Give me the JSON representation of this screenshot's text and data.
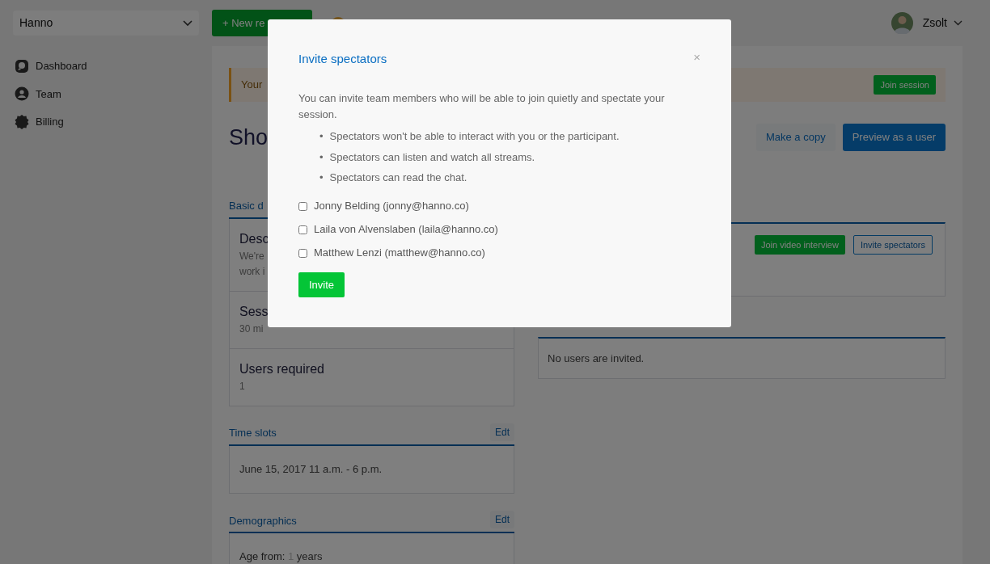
{
  "sidebar": {
    "team_selector": {
      "value": "Hanno"
    },
    "items": [
      {
        "label": "Dashboard",
        "kind": "dashboard"
      },
      {
        "label": "Team",
        "kind": "team"
      },
      {
        "label": "Billing",
        "kind": "billing"
      }
    ]
  },
  "top_bar": {
    "new_button": "+ New re",
    "user": {
      "name": "Zsolt"
    }
  },
  "alert": {
    "text": "Your",
    "button": "Join session"
  },
  "page": {
    "title": "Sho",
    "actions": [
      {
        "label": "Make a copy",
        "kind": "light"
      },
      {
        "label": "Preview as a user",
        "kind": "primary"
      }
    ]
  },
  "left_sections": [
    {
      "title": "Basic d",
      "rows": [
        {
          "label": "Desc",
          "lines": [
            "We're",
            "work i"
          ]
        },
        {
          "label": "Sess",
          "lines": [
            "30 mi"
          ]
        },
        {
          "label": "Users required",
          "lines": [
            "1"
          ]
        }
      ]
    },
    {
      "title": "Time slots",
      "edit": "Edt",
      "rows": [
        {
          "lines": [
            "June 15, 2017 11 a.m. - 6 p.m."
          ]
        }
      ]
    },
    {
      "title": "Demographics",
      "edit": "Edt",
      "rows": [
        {
          "label": "Age from:",
          "value": "1",
          "unit": "years"
        },
        {
          "lines": []
        }
      ]
    }
  ],
  "sessions_panel": {
    "buttons": [
      {
        "label": "Join video interview",
        "kind": "success"
      },
      {
        "label": "Invite spectators",
        "kind": "outline"
      }
    ]
  },
  "invited_panel": {
    "text": "No users are invited."
  },
  "modal": {
    "title": "Invite spectators",
    "close": "×",
    "intro": "You can invite team members who will be able to join quietly and spectate your session.",
    "marker": "•",
    "bullets": [
      "Spectators won't be able to interact with you or the participant.",
      "Spectators can listen and watch all streams.",
      "Spectators can read the chat."
    ],
    "members": [
      {
        "label": "Jonny Belding (jonny@hanno.co)",
        "checked": false
      },
      {
        "label": "Laila von Alvenslaben (laila@hanno.co)",
        "checked": false
      },
      {
        "label": "Matthew Lenzi (matthew@hanno.co)",
        "checked": false
      }
    ],
    "submit": "Invite"
  }
}
